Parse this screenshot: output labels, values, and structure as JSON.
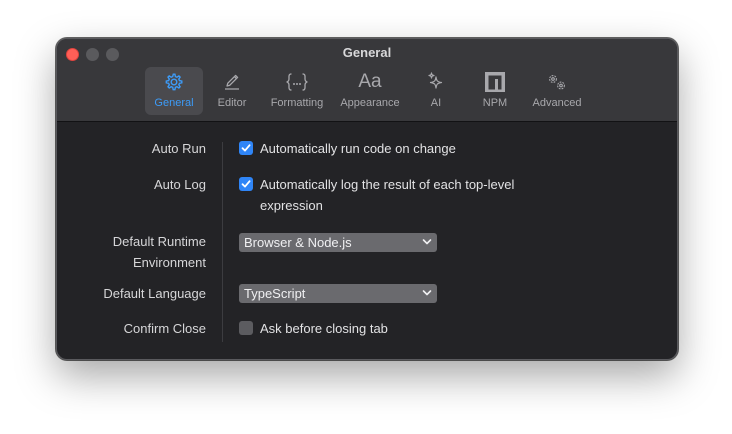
{
  "window": {
    "title": "General"
  },
  "toolbar": {
    "tabs": [
      {
        "label": "General",
        "icon": "gear-icon",
        "active": true
      },
      {
        "label": "Editor",
        "icon": "pencil-icon",
        "active": false
      },
      {
        "label": "Formatting",
        "icon": "braces-icon",
        "active": false
      },
      {
        "label": "Appearance",
        "icon": "font-aa-icon",
        "icon_text": "Aa",
        "active": false
      },
      {
        "label": "AI",
        "icon": "sparkle-icon",
        "active": false
      },
      {
        "label": "NPM",
        "icon": "npm-icon",
        "active": false
      },
      {
        "label": "Advanced",
        "icon": "gears-icon",
        "active": false
      }
    ]
  },
  "settings": {
    "auto_run": {
      "label": "Auto Run",
      "text": "Automatically run code on change",
      "checked": true
    },
    "auto_log": {
      "label": "Auto Log",
      "text": "Automatically log the result of each top-level expression",
      "checked": true
    },
    "default_runtime": {
      "label_line1": "Default Runtime",
      "label_line2": "Environment",
      "value": "Browser & Node.js"
    },
    "default_language": {
      "label": "Default Language",
      "value": "TypeScript"
    },
    "confirm_close": {
      "label": "Confirm Close",
      "text": "Ask before closing tab",
      "checked": false
    }
  },
  "colors": {
    "accent": "#3d9bf7",
    "checkbox_checked": "#2f85f7",
    "window_bg": "#232326",
    "titlebar_bg": "#38383b",
    "close_button": "#ff5f57"
  }
}
